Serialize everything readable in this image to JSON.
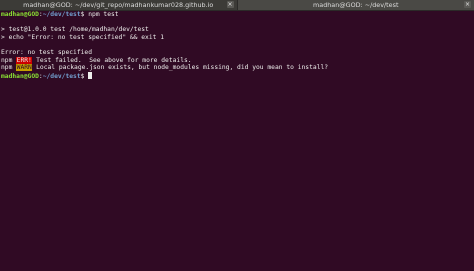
{
  "tabs": [
    {
      "title": "madhan@GOD: ~/dev/git_repo/madhankumar028.github.io",
      "close_icon": "close-icon"
    },
    {
      "title": "madhan@GOD: ~/dev/test",
      "close_icon": "close-icon"
    }
  ],
  "close_glyph": "×",
  "terminal": {
    "prompt_user": "madhan@GOD",
    "prompt_sep": ":",
    "prompt_path": "~/dev/test",
    "prompt_end": "$ ",
    "command": "npm test",
    "output": [
      "> test@1.0.0 test /home/madhan/dev/test",
      "> echo \"Error: no test specified\" && exit 1",
      "Error: no test specified"
    ],
    "npm_label": "npm",
    "err_badge": "ERR!",
    "err_text": " Test failed.  See above for more details.",
    "warn_badge": "WARN",
    "warn_text": " Local package.json exists, but node_modules missing, did you mean to install?"
  },
  "colors": {
    "background": "#300a24",
    "prompt_user": "#8ae234",
    "prompt_path": "#729fcf",
    "error_badge": "#cc0000",
    "warn_badge": "#c4a000"
  }
}
